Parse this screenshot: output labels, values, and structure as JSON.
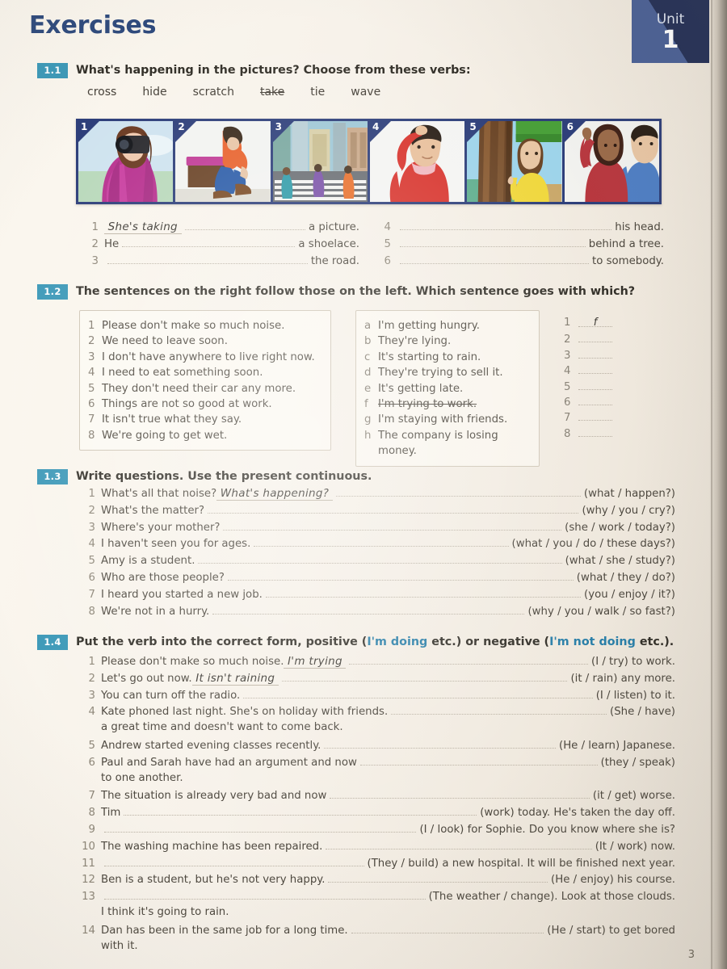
{
  "page": {
    "title": "Exercises",
    "page_number": "3",
    "unit_label": "Unit",
    "unit_number": "1",
    "colors": {
      "title": "#2e4a7d",
      "badge": "#3d99b8",
      "unit_badge_dark": "#232f56",
      "unit_badge_light": "#4a6096",
      "paper": "#f7f2ea",
      "highlight": "#2a7fa8"
    }
  },
  "exercises": [
    {
      "number": "1.1",
      "instruction": "What's happening in the pictures?  Choose from these verbs:",
      "verbs": [
        {
          "word": "cross",
          "used": false
        },
        {
          "word": "hide",
          "used": false
        },
        {
          "word": "scratch",
          "used": false
        },
        {
          "word": "take",
          "used": true
        },
        {
          "word": "tie",
          "used": false
        },
        {
          "word": "wave",
          "used": false
        }
      ],
      "pictures": [
        {
          "n": "1",
          "alt": "woman taking a photo with a camera"
        },
        {
          "n": "2",
          "alt": "man sitting on a box tying his shoelace"
        },
        {
          "n": "3",
          "alt": "people crossing the road at a crosswalk"
        },
        {
          "n": "4",
          "alt": "man scratching his head"
        },
        {
          "n": "5",
          "alt": "girl hiding behind a tree"
        },
        {
          "n": "6",
          "alt": "woman waving to somebody"
        }
      ],
      "left_items": [
        {
          "n": "1",
          "pre": "",
          "answer": "She's taking",
          "post": "a picture."
        },
        {
          "n": "2",
          "pre": "He",
          "answer": "",
          "post": "a shoelace."
        },
        {
          "n": "3",
          "pre": "",
          "answer": "",
          "post": "the road."
        }
      ],
      "right_items": [
        {
          "n": "4",
          "pre": "",
          "answer": "",
          "post": "his head."
        },
        {
          "n": "5",
          "pre": "",
          "answer": "",
          "post": "behind a tree."
        },
        {
          "n": "6",
          "pre": "",
          "answer": "",
          "post": "to somebody."
        }
      ]
    },
    {
      "number": "1.2",
      "instruction": "The sentences on the right follow those on the left.  Which sentence goes with which?",
      "left_box": [
        {
          "k": "1",
          "t": "Please don't make so much noise."
        },
        {
          "k": "2",
          "t": "We need to leave soon."
        },
        {
          "k": "3",
          "t": "I don't have anywhere to live right now."
        },
        {
          "k": "4",
          "t": "I need to eat something soon."
        },
        {
          "k": "5",
          "t": "They don't need their car any more."
        },
        {
          "k": "6",
          "t": "Things are not so good at work."
        },
        {
          "k": "7",
          "t": "It isn't true what they say."
        },
        {
          "k": "8",
          "t": "We're going to get wet."
        }
      ],
      "right_box": [
        {
          "k": "a",
          "t": "I'm getting hungry.",
          "struck": false
        },
        {
          "k": "b",
          "t": "They're lying.",
          "struck": false
        },
        {
          "k": "c",
          "t": "It's starting to rain.",
          "struck": false
        },
        {
          "k": "d",
          "t": "They're trying to sell it.",
          "struck": false
        },
        {
          "k": "e",
          "t": "It's getting late.",
          "struck": false
        },
        {
          "k": "f",
          "t": "I'm trying to work.",
          "struck": true
        },
        {
          "k": "g",
          "t": "I'm staying with friends.",
          "struck": false
        },
        {
          "k": "h",
          "t": "The company is losing money.",
          "struck": false
        }
      ],
      "answers": [
        {
          "k": "1",
          "v": "f"
        },
        {
          "k": "2",
          "v": ""
        },
        {
          "k": "3",
          "v": ""
        },
        {
          "k": "4",
          "v": ""
        },
        {
          "k": "5",
          "v": ""
        },
        {
          "k": "6",
          "v": ""
        },
        {
          "k": "7",
          "v": ""
        },
        {
          "k": "8",
          "v": ""
        }
      ]
    },
    {
      "number": "1.3",
      "instruction": "Write questions.  Use the present continuous.",
      "items": [
        {
          "n": "1",
          "pre": "What's all that noise?",
          "answer": "What's happening?",
          "cue": "(what / happen?)"
        },
        {
          "n": "2",
          "pre": "What's the matter?",
          "answer": "",
          "cue": "(why / you / cry?)"
        },
        {
          "n": "3",
          "pre": "Where's your mother?",
          "answer": "",
          "cue": "(she / work / today?)"
        },
        {
          "n": "4",
          "pre": "I haven't seen you for ages.",
          "answer": "",
          "cue": "(what / you / do / these days?)"
        },
        {
          "n": "5",
          "pre": "Amy is a student.",
          "answer": "",
          "cue": "(what / she / study?)"
        },
        {
          "n": "6",
          "pre": "Who are those people?",
          "answer": "",
          "cue": "(what / they / do?)"
        },
        {
          "n": "7",
          "pre": "I heard you started a new job.",
          "answer": "",
          "cue": "(you / enjoy / it?)"
        },
        {
          "n": "8",
          "pre": "We're not in a hurry.",
          "answer": "",
          "cue": "(why / you / walk / so fast?)"
        }
      ]
    },
    {
      "number": "1.4",
      "instruction_parts": [
        {
          "t": "Put the verb into the correct form, positive (",
          "hl": false
        },
        {
          "t": "I'm doing",
          "hl": true
        },
        {
          "t": " etc.) or negative (",
          "hl": false
        },
        {
          "t": "I'm not doing",
          "hl": true
        },
        {
          "t": " etc.).",
          "hl": false
        }
      ],
      "items": [
        {
          "n": "1",
          "pre": "Please don't make so much noise.",
          "answer": "I'm trying",
          "cue": "(I / try) to work.",
          "cont": ""
        },
        {
          "n": "2",
          "pre": "Let's go out now.",
          "answer": "It isn't raining",
          "cue": "(it / rain) any more.",
          "cont": ""
        },
        {
          "n": "3",
          "pre": "You can turn off the radio.",
          "answer": "",
          "cue": "(I / listen) to it.",
          "cont": ""
        },
        {
          "n": "4",
          "pre": "Kate phoned last night.  She's on holiday with friends.",
          "answer": "",
          "cue": "(She / have)",
          "cont": "a great time and doesn't want to come back."
        },
        {
          "n": "5",
          "pre": "Andrew started evening classes recently.",
          "answer": "",
          "cue": "(He / learn) Japanese.",
          "cont": ""
        },
        {
          "n": "6",
          "pre": "Paul and Sarah have had an argument and now",
          "answer": "",
          "cue": "(they / speak)",
          "cont": "to one another."
        },
        {
          "n": "7",
          "pre": "The situation is already very bad and now",
          "answer": "",
          "cue": "(it / get) worse.",
          "cont": ""
        },
        {
          "n": "8",
          "pre": "Tim",
          "answer": "",
          "cue": "(work) today.  He's taken the day off.",
          "cont": ""
        },
        {
          "n": "9",
          "pre": "",
          "answer": "",
          "cue": "(I / look) for Sophie.  Do you know where she is?",
          "cont": ""
        },
        {
          "n": "10",
          "pre": "The washing machine has been repaired.",
          "answer": "",
          "cue": "(It / work) now.",
          "cont": ""
        },
        {
          "n": "11",
          "pre": "",
          "answer": "",
          "cue": "(They / build) a new hospital.  It will be finished next year.",
          "cont": ""
        },
        {
          "n": "12",
          "pre": "Ben is a student, but he's not very happy.",
          "answer": "",
          "cue": "(He / enjoy) his course.",
          "cont": ""
        },
        {
          "n": "13",
          "pre": "",
          "answer": "",
          "cue": "(The weather / change).  Look at those clouds.",
          "cont": "I think it's going to rain."
        },
        {
          "n": "14",
          "pre": "Dan has been in the same job for a long time.",
          "answer": "",
          "cue": "(He / start) to get bored",
          "cont": "with it."
        }
      ]
    }
  ]
}
